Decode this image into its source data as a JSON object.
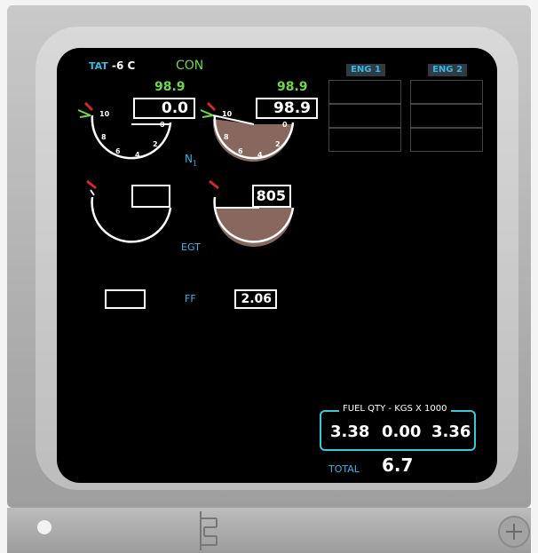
{
  "tat": {
    "label": "TAT",
    "value": "-6 C"
  },
  "thrust_mode": "CON",
  "n1": {
    "label": "N",
    "subscript": "1",
    "eng1": {
      "target": "98.9",
      "value": "0.0",
      "level": 0.0
    },
    "eng2": {
      "target": "98.9",
      "value": "98.9",
      "level": 0.989
    },
    "ticks": [
      "10",
      "8",
      "6",
      "4",
      "2",
      "0"
    ]
  },
  "egt": {
    "label": "EGT",
    "eng1": {
      "value": ""
    },
    "eng2": {
      "value": "805"
    }
  },
  "ff": {
    "label": "FF",
    "eng1": {
      "value": ""
    },
    "eng2": {
      "value": "2.06"
    }
  },
  "eng_headers": [
    "ENG 1",
    "ENG 2"
  ],
  "fuel": {
    "title": "FUEL QTY - KGS X 1000",
    "left": "3.38",
    "center": "0.00",
    "right": "3.36",
    "total_label": "TOTAL",
    "total_value": "6.7"
  },
  "colors": {
    "cyan": "#36b7e8",
    "green": "#6ed84a",
    "red": "#d8262a",
    "fuel_box": "#37c9d9",
    "dial_fill": "#a07a6e"
  }
}
